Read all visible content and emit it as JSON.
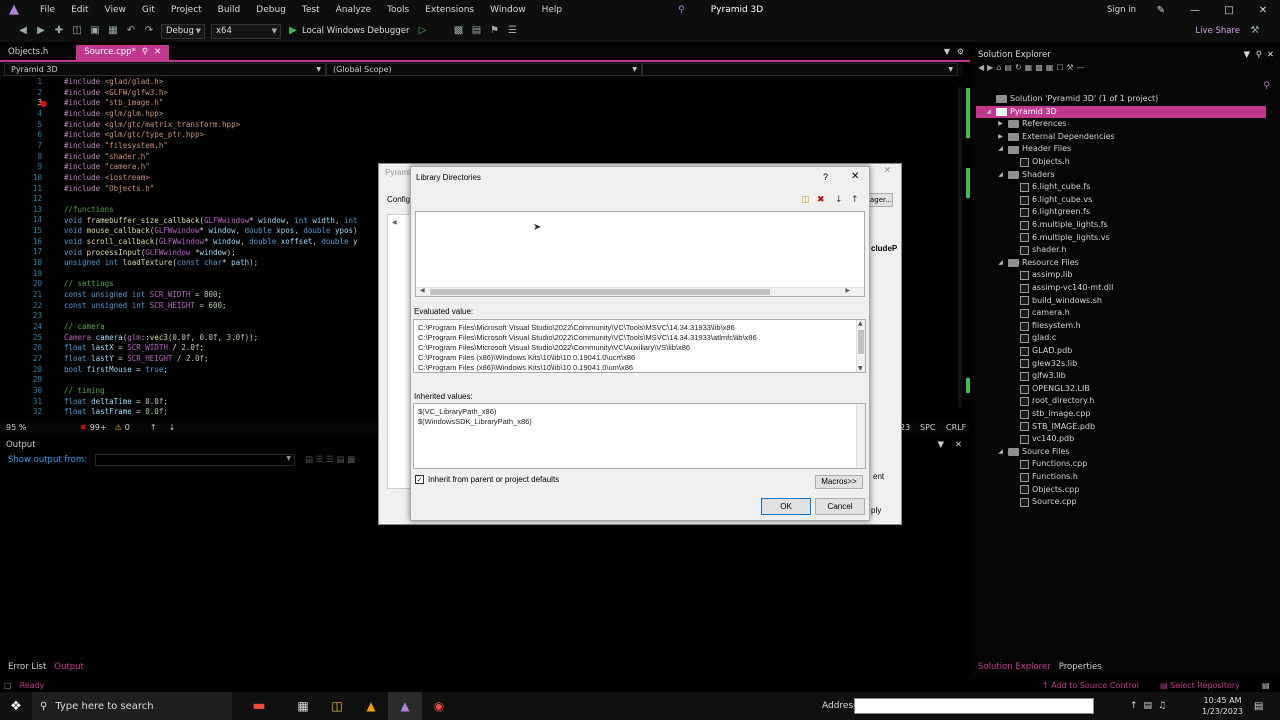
{
  "app": {
    "title": "Pyramid 3D",
    "signin": "Sign in",
    "liveshare": "Live Share"
  },
  "menu": [
    "File",
    "Edit",
    "View",
    "Git",
    "Project",
    "Build",
    "Debug",
    "Test",
    "Analyze",
    "Tools",
    "Extensions",
    "Window",
    "Help"
  ],
  "toolbar": {
    "config": "Debug",
    "platform": "x64",
    "debugger": "Local Windows Debugger"
  },
  "tabs": [
    {
      "label": "Objects.h"
    },
    {
      "label": "Source.cpp*"
    }
  ],
  "nav": {
    "project": "Pyramid 3D",
    "scope": "(Global Scope)"
  },
  "editor": {
    "lines": [
      "1",
      "2",
      "3",
      "4",
      "5",
      "6",
      "7",
      "8",
      "9",
      "10",
      "11",
      "12",
      "13",
      "14",
      "15",
      "16",
      "17",
      "18",
      "19",
      "20",
      "21",
      "22",
      "23",
      "24",
      "25",
      "26",
      "27",
      "28",
      "29",
      "30",
      "31",
      "32"
    ],
    "zoom": "95 %",
    "errors": "99+",
    "warnings": "0"
  },
  "editor_status": {
    "spc": "SPC",
    "crlf": "CRLF",
    "col": "23"
  },
  "output": {
    "title": "Output",
    "show_from": "Show output from:"
  },
  "bottom_tabs": [
    "Error List",
    "Output"
  ],
  "status": {
    "ready": "Ready",
    "add_source": "Add to Source Control",
    "select_repo": "Select Repository"
  },
  "taskbar": {
    "search": "Type here to search",
    "address": "Address",
    "time": "10:45 AM",
    "date": "1/23/2023"
  },
  "solution_explorer": {
    "title": "Solution Explorer",
    "bottom_tabs": [
      "Solution Explorer",
      "Properties"
    ],
    "nodes": [
      {
        "label": "Solution 'Pyramid 3D' (1 of 1 project)",
        "depth": 0,
        "kind": "solution"
      },
      {
        "label": "Pyramid 3D",
        "depth": 0,
        "kind": "project",
        "selected": true
      },
      {
        "label": "References",
        "depth": 1,
        "kind": "folder"
      },
      {
        "label": "External Dependencies",
        "depth": 1,
        "kind": "folder"
      },
      {
        "label": "Header Files",
        "depth": 1,
        "kind": "folder"
      },
      {
        "label": "Objects.h",
        "depth": 2,
        "kind": "file"
      },
      {
        "label": "Shaders",
        "depth": 1,
        "kind": "folder"
      },
      {
        "label": "6.light_cube.fs",
        "depth": 2,
        "kind": "file"
      },
      {
        "label": "6.light_cube.vs",
        "depth": 2,
        "kind": "file"
      },
      {
        "label": "6.lightgreen.fs",
        "depth": 2,
        "kind": "file"
      },
      {
        "label": "6.multiple_lights.fs",
        "depth": 2,
        "kind": "file"
      },
      {
        "label": "6.multiple_lights.vs",
        "depth": 2,
        "kind": "file"
      },
      {
        "label": "shader.h",
        "depth": 2,
        "kind": "file"
      },
      {
        "label": "Resource Files",
        "depth": 1,
        "kind": "folder"
      },
      {
        "label": "assimp.lib",
        "depth": 2,
        "kind": "file"
      },
      {
        "label": "assimp-vc140-mt.dll",
        "depth": 2,
        "kind": "file"
      },
      {
        "label": "build_windows.sh",
        "depth": 2,
        "kind": "file"
      },
      {
        "label": "camera.h",
        "depth": 2,
        "kind": "file"
      },
      {
        "label": "filesystem.h",
        "depth": 2,
        "kind": "file"
      },
      {
        "label": "glad.c",
        "depth": 2,
        "kind": "file"
      },
      {
        "label": "GLAD.pdb",
        "depth": 2,
        "kind": "file"
      },
      {
        "label": "glew32s.lib",
        "depth": 2,
        "kind": "file"
      },
      {
        "label": "glfw3.lib",
        "depth": 2,
        "kind": "file"
      },
      {
        "label": "OPENGL32.LIB",
        "depth": 2,
        "kind": "file"
      },
      {
        "label": "root_directory.h",
        "depth": 2,
        "kind": "file"
      },
      {
        "label": "stb_image.cpp",
        "depth": 2,
        "kind": "file"
      },
      {
        "label": "STB_IMAGE.pdb",
        "depth": 2,
        "kind": "file"
      },
      {
        "label": "vc140.pdb",
        "depth": 2,
        "kind": "file"
      },
      {
        "label": "Source Files",
        "depth": 1,
        "kind": "folder"
      },
      {
        "label": "Functions.cpp",
        "depth": 2,
        "kind": "file"
      },
      {
        "label": "Functions.h",
        "depth": 2,
        "kind": "file"
      },
      {
        "label": "Objects.cpp",
        "depth": 2,
        "kind": "file"
      },
      {
        "label": "Source.cpp",
        "depth": 2,
        "kind": "file"
      }
    ]
  },
  "property_dialog": {
    "title": "Pyramid",
    "config_label": "Config",
    "fragment_r": "cludeP",
    "ager": "ager...",
    "ent": "ent",
    "ply": "ply"
  },
  "library_dialog": {
    "title": "Library Directories",
    "help": "?",
    "evaluated_label": "Evaluated value:",
    "evaluated": [
      "C:\\Program Files\\Microsoft Visual Studio\\2022\\Community\\VC\\Tools\\MSVC\\14.34.31933\\lib\\x86",
      "C:\\Program Files\\Microsoft Visual Studio\\2022\\Community\\VC\\Tools\\MSVC\\14.34.31933\\atlmfc\\lib\\x86",
      "C:\\Program Files\\Microsoft Visual Studio\\2022\\Community\\VC\\Auxiliary\\VS\\lib\\x86",
      "C:\\Program Files (x86)\\Windows Kits\\10\\lib\\10.0.19041.0\\ucrt\\x86",
      "C:\\Program Files (x86)\\Windows Kits\\10\\lib\\10.0.19041.0\\um\\x86"
    ],
    "inherited_label": "Inherited values:",
    "inherited": [
      "$(VC_LibraryPath_x86)",
      "$(WindowsSDK_LibraryPath_x86)"
    ],
    "inherit_checkbox": "Inherit from parent or project defaults",
    "macros": "Macros>>",
    "ok": "OK",
    "cancel": "Cancel"
  }
}
